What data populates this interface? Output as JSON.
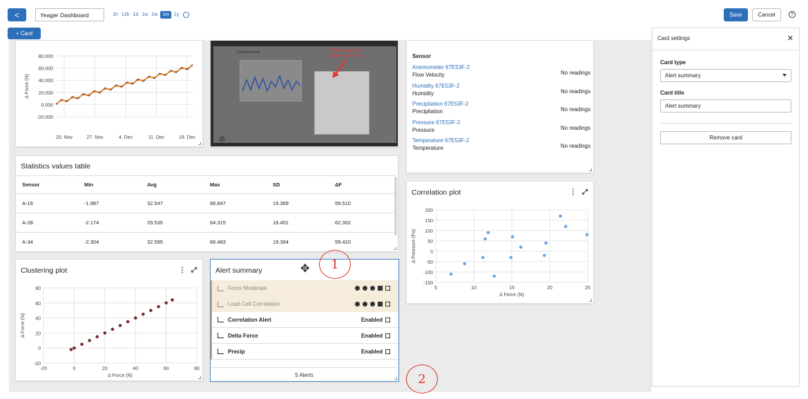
{
  "header": {
    "back_label": "<",
    "dashboard_title": "Yeager Dashboard",
    "ranges": [
      "1h",
      "12h",
      "1d",
      "1w",
      "2w",
      "1m",
      "1y"
    ],
    "active_range": "1m",
    "save_label": "Save",
    "cancel_label": "Cancel",
    "help_label": "?",
    "add_card_label": "+ Card"
  },
  "force_chart": {
    "chart_data": {
      "type": "line",
      "title": "",
      "xlabel": "",
      "ylabel": "Δ Force (N)",
      "ylim": [
        -20000,
        80000
      ],
      "y_ticks": [
        "80.000",
        "60.000",
        "40.000",
        "20.000",
        "0.000",
        "-20.000"
      ],
      "x_ticks": [
        "20. Nov",
        "27. Nov",
        "4. Dec",
        "11. Dec",
        "18. Dec"
      ],
      "series": [
        {
          "color": "#7a2a2a",
          "x": [
            0,
            4,
            8,
            12,
            16,
            20,
            24,
            28,
            32,
            36,
            40,
            44,
            48,
            52,
            56,
            60,
            64,
            68,
            72,
            76,
            80,
            84,
            88,
            92,
            96,
            100
          ],
          "values": [
            0,
            5000,
            3000,
            8000,
            6000,
            11000,
            9000,
            14000,
            12000,
            17000,
            15000,
            20000,
            18000,
            23000,
            21000,
            26000,
            24000,
            29000,
            27000,
            32000,
            30000,
            35000,
            33000,
            38000,
            36000,
            41000
          ]
        },
        {
          "color": "#e08a2a",
          "x": [
            0,
            4,
            8,
            12,
            16,
            20,
            24,
            28,
            32,
            36,
            40,
            44,
            48,
            52,
            56,
            60,
            64,
            68,
            72,
            76,
            80,
            84,
            88,
            92,
            96,
            100
          ],
          "values": [
            1000,
            4000,
            4000,
            7000,
            7000,
            10000,
            10000,
            13000,
            13000,
            16000,
            16000,
            19000,
            19000,
            22000,
            22000,
            25000,
            25000,
            28000,
            28000,
            31000,
            31000,
            34000,
            34000,
            37000,
            37000,
            40000
          ]
        }
      ]
    }
  },
  "screenshot_card": {
    "dashboard_label": "Dashboard title",
    "annotation": "Please place a delete icon here"
  },
  "sensor_card": {
    "heading": "Sensor",
    "rows": [
      {
        "link": "Anemometer 67E53F-2",
        "name": "Flow Velocity",
        "value": "No readings"
      },
      {
        "link": "Humidity 67E53F-2",
        "name": "Humidity",
        "value": "No readings"
      },
      {
        "link": "Precipitation 67E53F-2",
        "name": "Precipitation",
        "value": "No readings"
      },
      {
        "link": "Pressure 67E53F-2",
        "name": "Pressure",
        "value": "No readings"
      },
      {
        "link": "Temperature 67E53F-2",
        "name": "Temperature",
        "value": "No readings"
      }
    ]
  },
  "stats_table": {
    "title": "Statistics values table",
    "columns": [
      "Sensor",
      "Min",
      "Avg",
      "Max",
      "SD",
      "ΔF"
    ],
    "rows": [
      [
        "A-16",
        "-1.987",
        "32.547",
        "66.847",
        "19.369",
        "59.510"
      ],
      [
        "A-28",
        "-2.174",
        "29.535",
        "64.315",
        "18.401",
        "62.302"
      ],
      [
        "A-34",
        "-2.304",
        "32.595",
        "66.483",
        "19.364",
        "59.410"
      ]
    ]
  },
  "correlation_plot": {
    "title": "Correlation plot",
    "chart_data": {
      "type": "scatter",
      "title": "",
      "xlabel": "Δ Force (N)",
      "ylabel": "Δ Pressure (Pa)",
      "xlim": [
        5,
        25
      ],
      "ylim": [
        -150,
        200
      ],
      "x_ticks": [
        "5",
        "10",
        "15",
        "20",
        "25"
      ],
      "y_ticks": [
        "200",
        "150",
        "100",
        "50",
        "0",
        "-50",
        "-100",
        "-150"
      ],
      "x": [
        7,
        8.8,
        11.2,
        11.5,
        11.9,
        12.7,
        14.9,
        15.1,
        16.2,
        19.3,
        19.5,
        21.4,
        22.1,
        24.9
      ],
      "y": [
        -110,
        -60,
        -30,
        60,
        90,
        -120,
        -30,
        70,
        20,
        -20,
        40,
        170,
        120,
        80
      ],
      "color": "#6aa5e0"
    }
  },
  "clustering_plot": {
    "title": "Clustering plot",
    "chart_data": {
      "type": "scatter",
      "title": "",
      "xlabel": "Δ Force (N)",
      "ylabel": "Δ Force (N)",
      "xlim": [
        -20,
        80
      ],
      "ylim": [
        -20,
        80
      ],
      "x_ticks": [
        "-20",
        "0",
        "20",
        "40",
        "60",
        "80"
      ],
      "y_ticks": [
        "80",
        "60",
        "40",
        "20",
        "0",
        "-20"
      ],
      "x": [
        -2,
        0,
        5,
        10,
        15,
        20,
        25,
        30,
        35,
        40,
        45,
        50,
        55,
        60,
        64
      ],
      "y": [
        -2,
        0,
        5,
        10,
        15,
        20,
        25,
        30,
        35,
        40,
        45,
        50,
        55,
        60,
        64
      ],
      "color": "#7a2a2a"
    }
  },
  "alert_summary": {
    "title": "Alert summary",
    "items": [
      {
        "label": "Force Moderate",
        "status": ""
      },
      {
        "label": "Load Cell Correlation",
        "status": ""
      },
      {
        "label": "Correlation Alert",
        "status": "Enabled"
      },
      {
        "label": "Delta Force",
        "status": "Enabled"
      },
      {
        "label": "Precip",
        "status": "Enabled"
      }
    ],
    "footer": "5 Alerts"
  },
  "card_settings": {
    "title": "Card settings",
    "type_label": "Card type",
    "type_value": "Alert summary",
    "title_label": "Card title",
    "title_value": "Alert summary",
    "remove_label": "Remove card"
  },
  "annotations": [
    "1",
    "2"
  ]
}
